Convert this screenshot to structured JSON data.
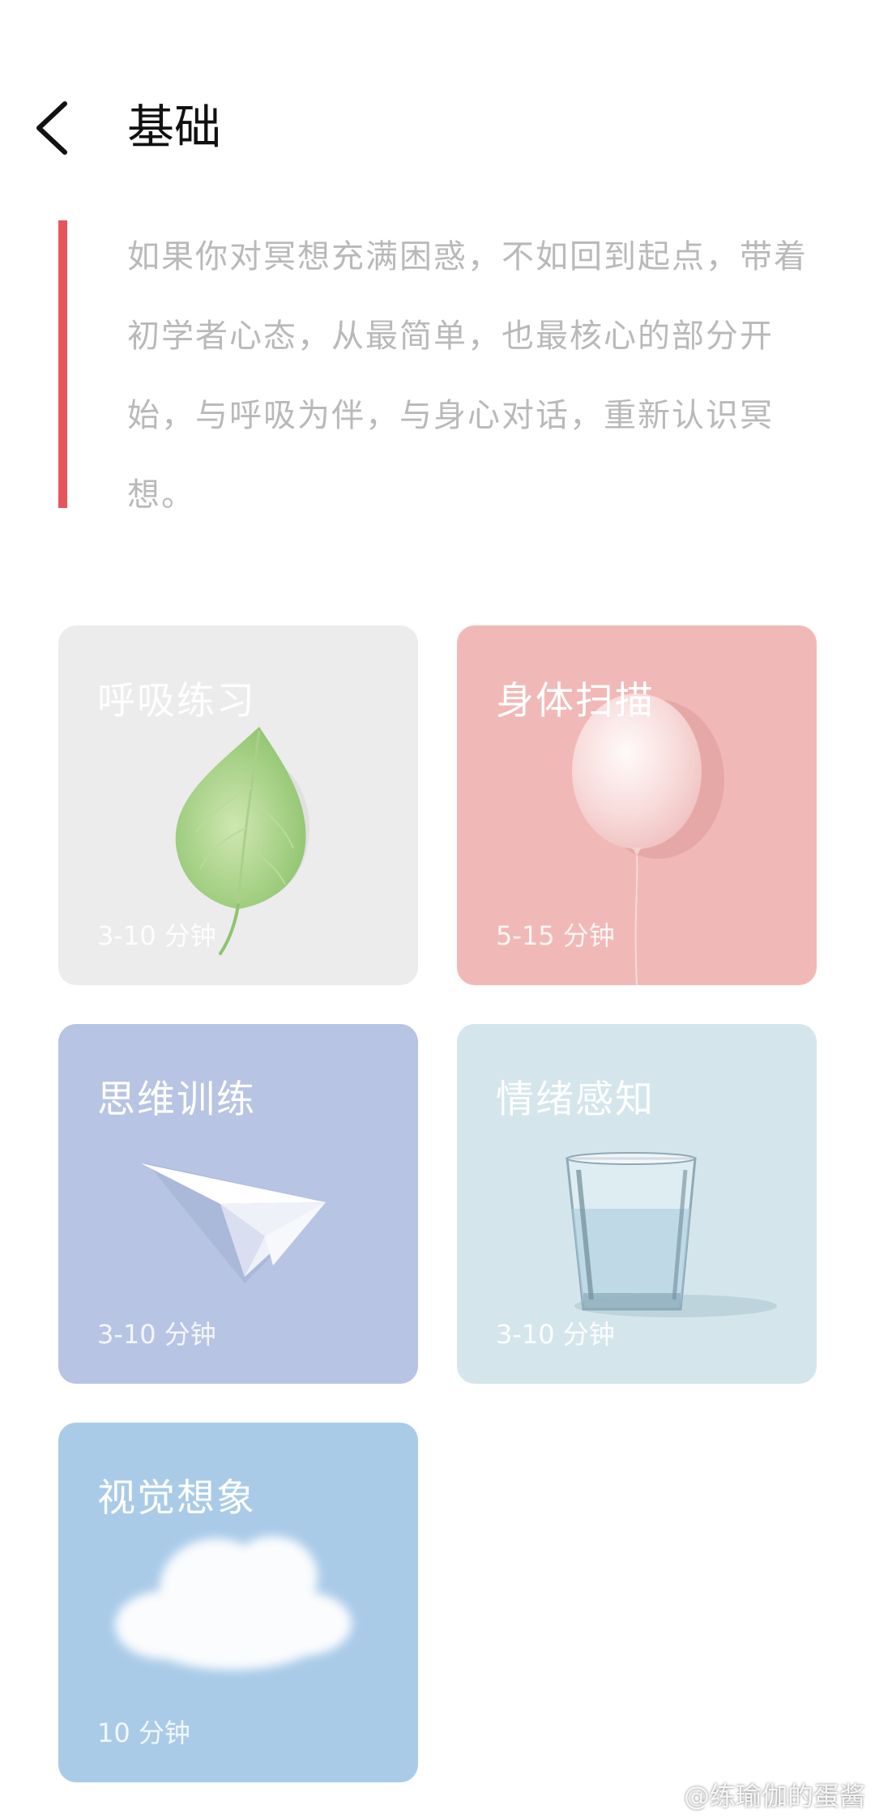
{
  "header": {
    "title": "基础",
    "back_icon": "chevron-left-icon"
  },
  "intro": {
    "text": "如果你对冥想充满困惑，不如回到起点，带着初学者心态，从最简单，也最核心的部分开始，与呼吸为伴，与身心对话，重新认识冥想。",
    "accent_color": "#e8545c"
  },
  "cards": [
    {
      "title": "呼吸练习",
      "duration": "3-10 分钟",
      "icon": "leaf-icon",
      "bg": "#ececec"
    },
    {
      "title": "身体扫描",
      "duration": "5-15 分钟",
      "icon": "balloon-icon",
      "bg": "#f0b9b7"
    },
    {
      "title": "思维训练",
      "duration": "3-10 分钟",
      "icon": "paper-plane-icon",
      "bg": "#b7c4e3"
    },
    {
      "title": "情绪感知",
      "duration": "3-10 分钟",
      "icon": "water-glass-icon",
      "bg": "#d4e6ec"
    },
    {
      "title": "视觉想象",
      "duration": "10 分钟",
      "icon": "cloud-icon",
      "bg": "#a9cbe8"
    }
  ],
  "watermark": "@练瑜伽的蛋酱"
}
